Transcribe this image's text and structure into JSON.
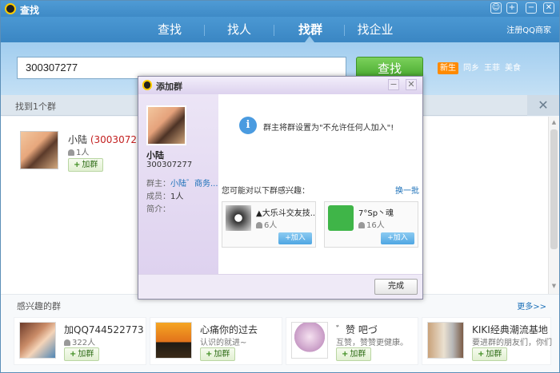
{
  "window": {
    "title": "查找",
    "controls": [
      "☺",
      "+",
      "−",
      "✕"
    ]
  },
  "header": {
    "tabs": [
      {
        "label": "查找"
      },
      {
        "label": "找人"
      },
      {
        "label": "找群"
      },
      {
        "label": "找企业"
      }
    ],
    "active_tab": "找群",
    "register_link": "注册QQ商家"
  },
  "search": {
    "query": "300307277",
    "button_label": "查找",
    "tags": [
      {
        "label": "新生",
        "hot": true
      },
      {
        "label": "同乡",
        "hot": false
      },
      {
        "label": "王菲",
        "hot": false
      },
      {
        "label": "美食",
        "hot": false
      }
    ]
  },
  "results": {
    "count_text": "找到1个群",
    "close_glyph": "✕",
    "items": [
      {
        "name": "小陆",
        "qq": "(300307277)",
        "members": "1人",
        "join_label": "加群"
      }
    ]
  },
  "interest": {
    "title": "感兴趣的群",
    "more_label": "更多>>",
    "cards": [
      {
        "name": "加QQ744522773",
        "sub": "322人",
        "join_label": "加群"
      },
      {
        "name": "心痛你的过去",
        "sub": "认识的就进~",
        "join_label": "加群"
      },
      {
        "name": "゛赞 吧づ",
        "sub": "互赞，赞赞更健康。",
        "join_label": "加群"
      },
      {
        "name": "KIKI经典潮流基地",
        "sub": "要进群的朋友们，你们",
        "join_label": "加群"
      }
    ]
  },
  "dialog": {
    "title": "添加群",
    "group_name": "小陆",
    "group_qq": "300307277",
    "owner_label": "群主：",
    "owner_value": "小陆゛商务...",
    "members_label": "成员：",
    "members_value": "1人",
    "intro_label": "简介：",
    "notice": "群主将群设置为\"不允许任何人加入\"!",
    "suggest_label": "您可能对以下群感兴趣：",
    "refresh_label": "换一批",
    "suggestions": [
      {
        "name": "▲大乐斗交友技...",
        "count": "6人",
        "add_label": "加入"
      },
      {
        "name": "7°Sp丶魂",
        "count": "16人",
        "add_label": "加入"
      }
    ],
    "done_label": "完成"
  }
}
